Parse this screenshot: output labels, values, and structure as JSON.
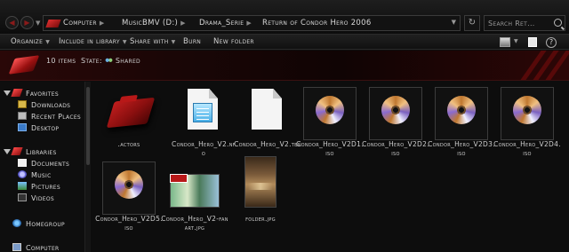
{
  "nav": {
    "back_glyph": "◀",
    "fwd_glyph": "▶",
    "dropdown_glyph": "▼"
  },
  "address": {
    "crumbs": [
      "Computer",
      "MusicBMV (D:)",
      "Drama_Serie",
      "Return of Condor Hero 2006"
    ],
    "separator": "▶",
    "dropdown_glyph": "▼"
  },
  "refresh_glyph": "↻",
  "search": {
    "placeholder": "Search Ret..."
  },
  "toolbar": {
    "organize": "Organize",
    "include": "Include in library",
    "share": "Share with",
    "burn": "Burn",
    "new_folder": "New folder",
    "caret": "▼",
    "help_glyph": "?"
  },
  "banner": {
    "count": "10 items",
    "state_label": "State:",
    "state_value": "Shared"
  },
  "sidebar": {
    "favorites": "Favorites",
    "downloads": "Downloads",
    "recent": "Recent Places",
    "desktop": "Desktop",
    "libraries": "Libraries",
    "documents": "Documents",
    "music": "Music",
    "pictures": "Pictures",
    "videos": "Videos",
    "homegroup": "Homegroup",
    "computer": "Computer"
  },
  "files": [
    {
      "name": ".actors",
      "type": "folder",
      "icon": "red-folder-icon"
    },
    {
      "name": "Condor_Hero_V2.nfo",
      "type": "nfo",
      "icon": "notepad-icon"
    },
    {
      "name": "Condor_Hero_V2.tbn",
      "type": "tbn",
      "icon": "blank-file-icon"
    },
    {
      "name": "Condor_Hero_V2D1.iso",
      "type": "iso",
      "icon": "disc-icon"
    },
    {
      "name": "Condor_Hero_V2D2.iso",
      "type": "iso",
      "icon": "disc-icon"
    },
    {
      "name": "Condor_Hero_V2D3.iso",
      "type": "iso",
      "icon": "disc-icon"
    },
    {
      "name": "Condor_Hero_V2D4.iso",
      "type": "iso",
      "icon": "disc-icon"
    },
    {
      "name": "Condor_Hero_V2D5.iso",
      "type": "iso",
      "icon": "disc-icon"
    },
    {
      "name": "Condor_Hero_V2-fanart.jpg",
      "type": "jpg",
      "icon": "image-thumbnail"
    },
    {
      "name": "folder.jpg",
      "type": "jpg",
      "icon": "image-thumbnail"
    }
  ],
  "colors": {
    "accent": "#b81818",
    "background": "#0d0d0d",
    "text": "#cfcfcf"
  }
}
